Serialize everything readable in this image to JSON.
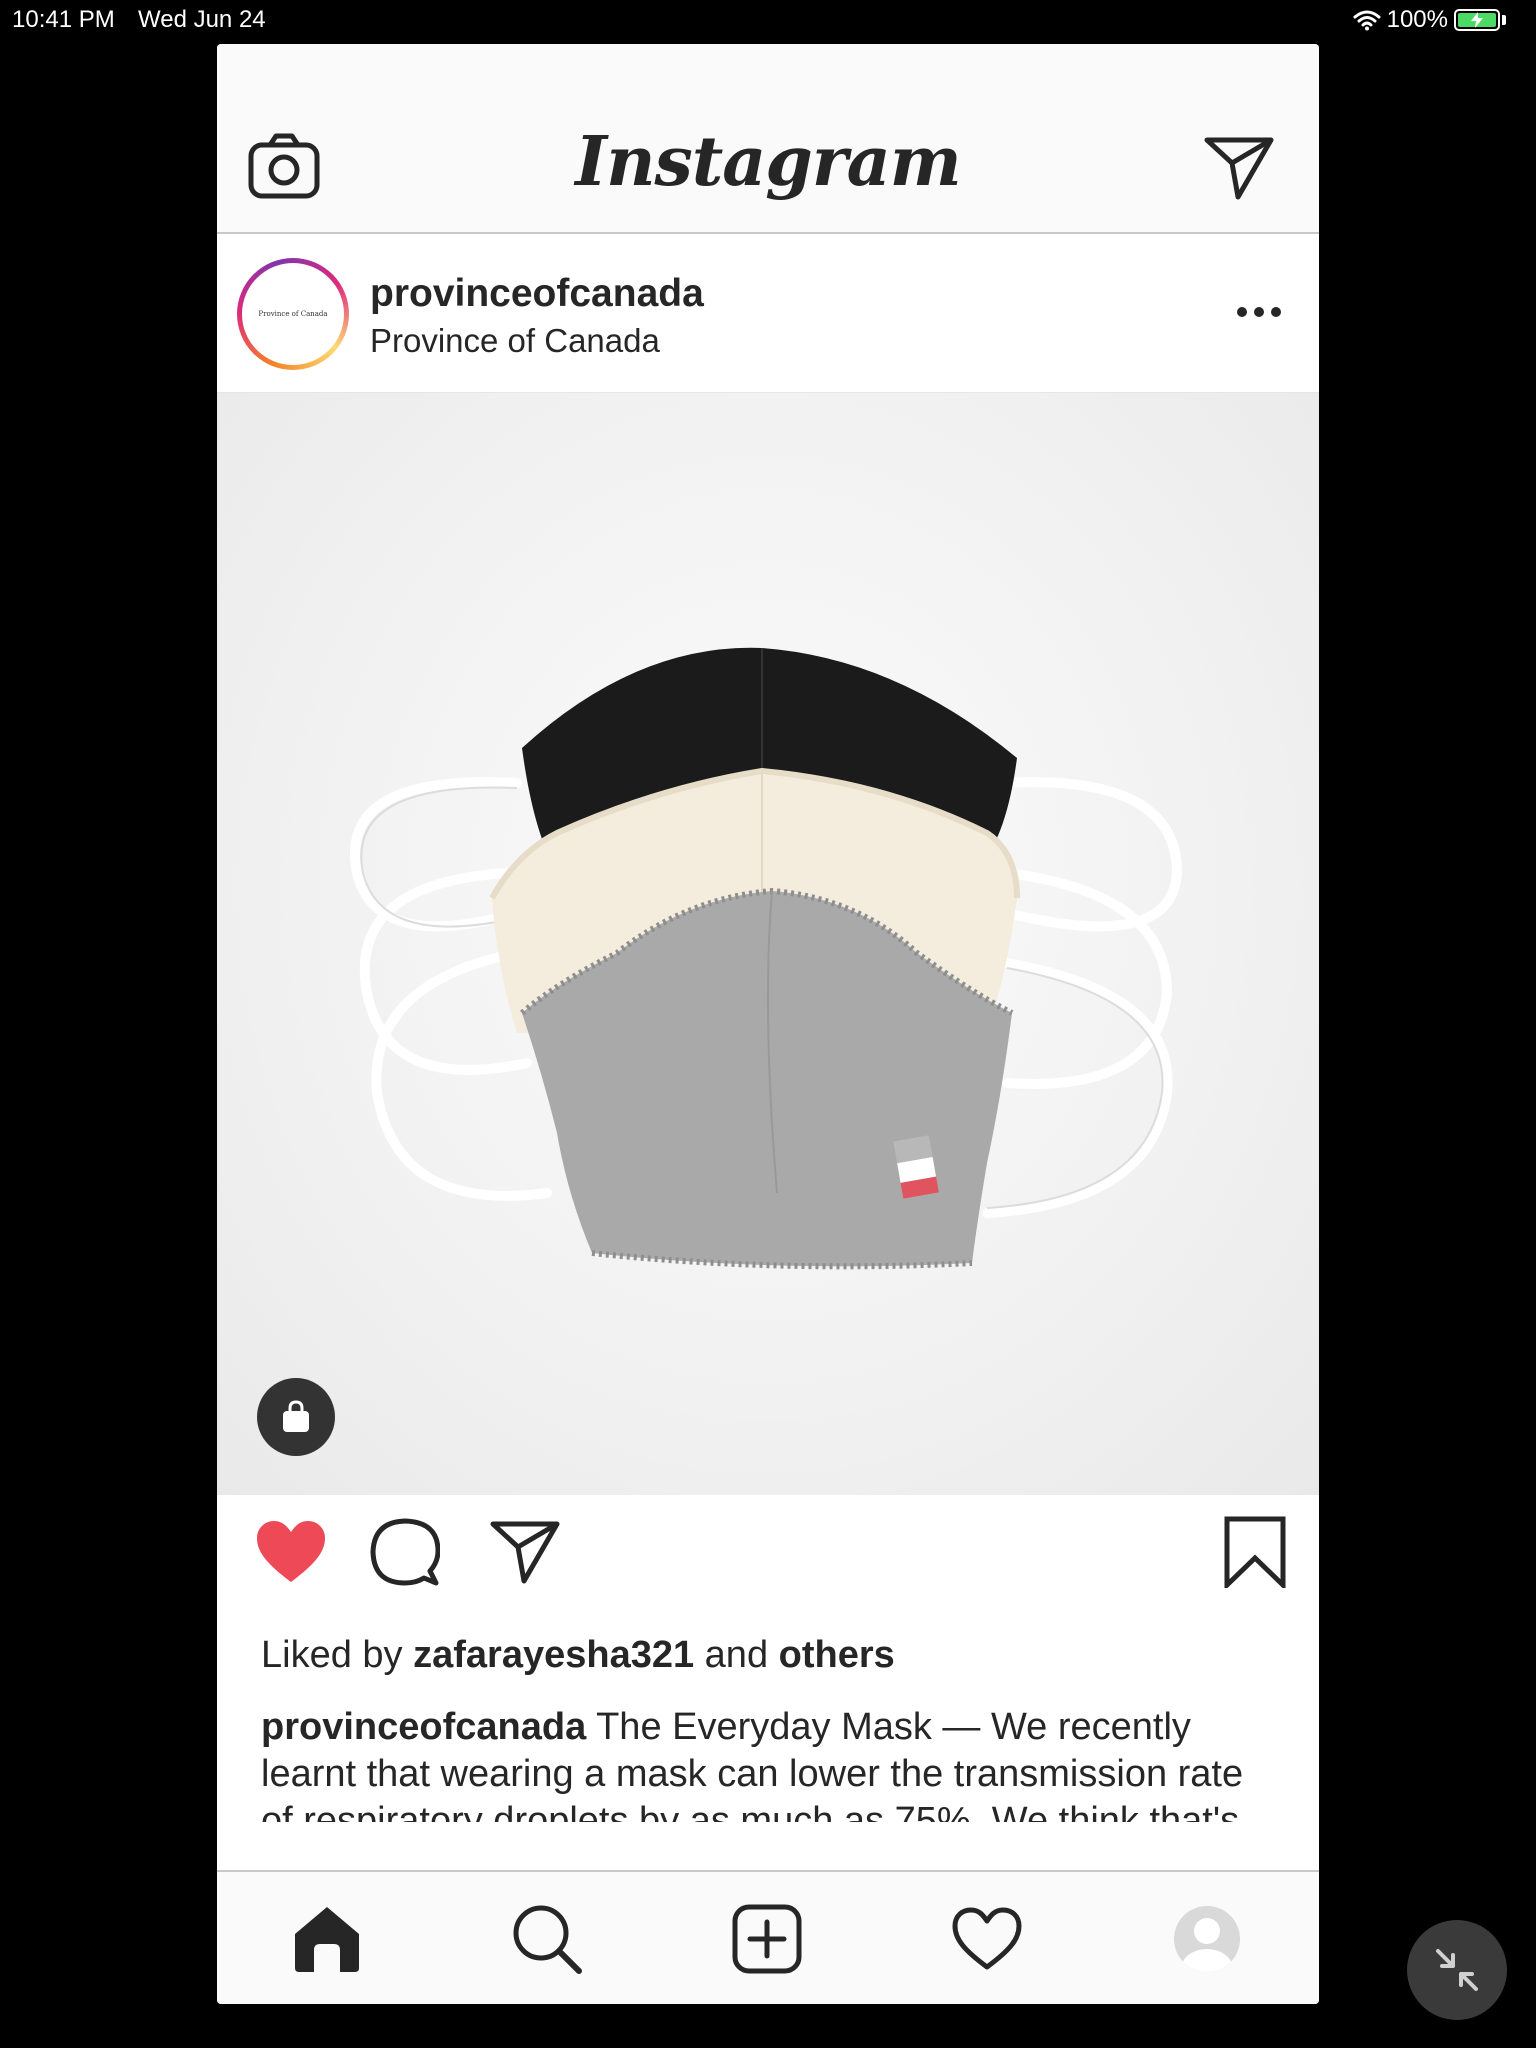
{
  "status_bar": {
    "time": "10:41 PM",
    "date": "Wed Jun 24",
    "battery": "100%",
    "icons": [
      "wifi-icon",
      "battery-charging-icon"
    ]
  },
  "header": {
    "logo_text": "Instagram",
    "left_icon": "camera-icon",
    "right_icon": "direct-message-icon"
  },
  "post": {
    "username": "provinceofcanada",
    "location": "Province of Canada",
    "avatar_text": "Province of Canada",
    "menu_icon": "more-options-icon",
    "image_icon": "shopping-bag-icon",
    "liked": true,
    "likes": {
      "prefix": "Liked by",
      "user": "zafarayesha321",
      "conjunction": "and",
      "others": "others"
    },
    "caption": {
      "username": "provinceofcanada",
      "text": "The Everyday Mask — We recently learnt that wearing a mask can lower the transmission rate of respiratory droplets by as much as 75%. We think that's pretty significant in the fight"
    }
  },
  "actions": [
    "heart-filled-icon",
    "comment-icon",
    "share-icon",
    "bookmark-icon"
  ],
  "tabbar": [
    "home-icon",
    "search-icon",
    "add-post-icon",
    "activity-heart-icon",
    "profile-icon"
  ],
  "colors": {
    "like_red": "#ed4956",
    "text": "#262626",
    "background": "#000000",
    "battery_green": "#4cd964"
  }
}
